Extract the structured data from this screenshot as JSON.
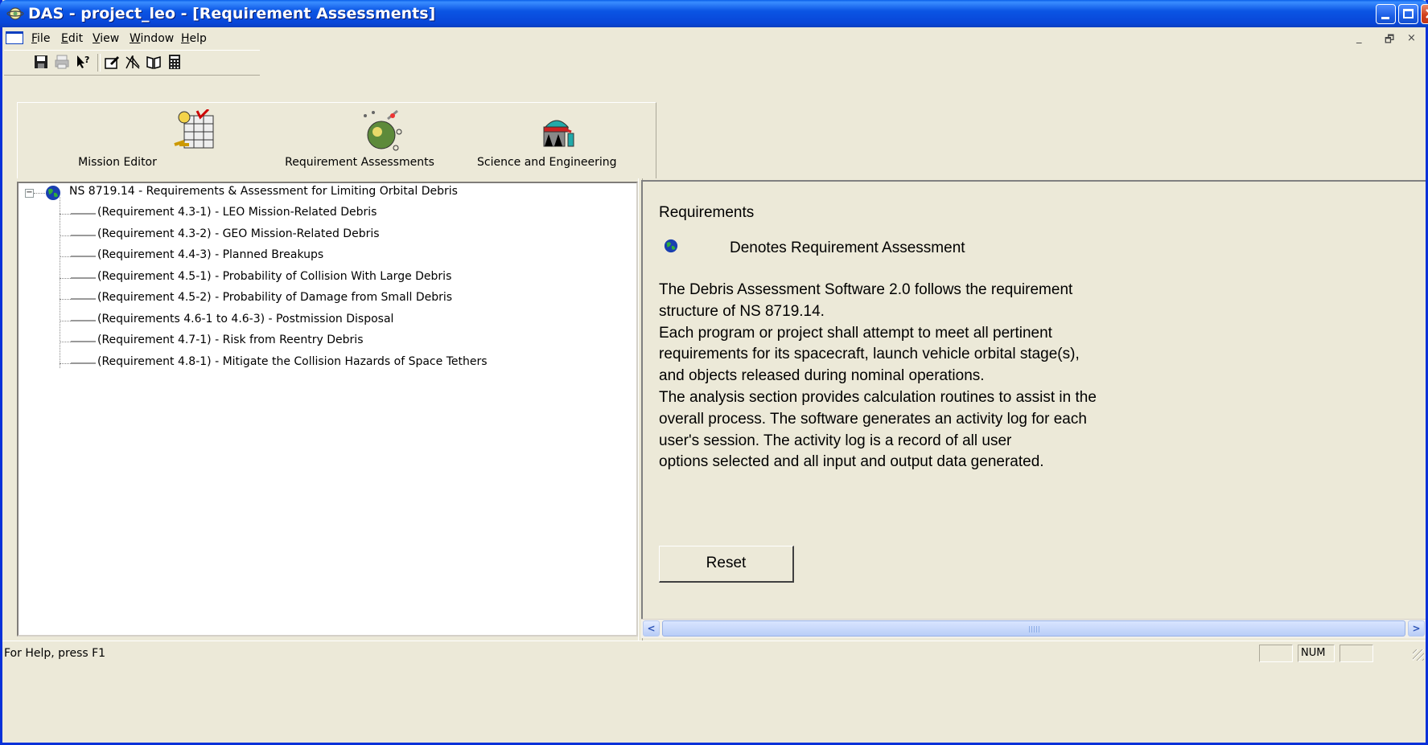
{
  "window": {
    "title": "DAS - project_leo - [Requirement Assessments]",
    "accent_color": "#0a55e4"
  },
  "menubar": {
    "items": [
      {
        "label": "File",
        "mnemonic": "F",
        "rest": "ile"
      },
      {
        "label": "Edit",
        "mnemonic": "E",
        "rest": "dit"
      },
      {
        "label": "View",
        "mnemonic": "V",
        "rest": "iew"
      },
      {
        "label": "Window",
        "mnemonic": "W",
        "rest": "indow"
      },
      {
        "label": "Help",
        "mnemonic": "H",
        "rest": "elp"
      }
    ],
    "mdi_controls": [
      "_",
      "🗗",
      "×"
    ]
  },
  "toolbar": {
    "icons": [
      "save-icon",
      "print-icon",
      "context-help-icon",
      "edit-icon",
      "chart-icon",
      "book-icon",
      "calculator-icon"
    ]
  },
  "modules": [
    {
      "label": "Mission Editor",
      "icon": "mission-editor-icon"
    },
    {
      "label": "Requirement Assessments",
      "icon": "requirement-assessments-icon"
    },
    {
      "label": "Science and Engineering",
      "icon": "science-engineering-icon"
    }
  ],
  "tree": {
    "root": "NS 8719.14 - Requirements & Assessment for Limiting Orbital Debris",
    "children": [
      "(Requirement 4.3-1) - LEO Mission-Related Debris",
      "(Requirement 4.3-2) - GEO Mission-Related Debris",
      "(Requirement 4.4-3) - Planned Breakups",
      "(Requirement 4.5-1) - Probability of Collision With Large Debris",
      "(Requirement 4.5-2) - Probability of Damage from Small Debris",
      "(Requirements 4.6-1 to 4.6-3) - Postmission Disposal",
      "(Requirement 4.7-1) - Risk from Reentry Debris",
      "(Requirement 4.8-1) - Mitigate the Collision Hazards of Space Tethers"
    ]
  },
  "info": {
    "heading": "Requirements",
    "legend": "Denotes Requirement Assessment",
    "body": "The Debris Assessment Software 2.0  follows the requirement\nstructure of NS 8719.14.\nEach program or project shall attempt to meet all pertinent\nrequirements for its spacecraft, launch vehicle orbital stage(s),\nand objects released during nominal operations.\nThe analysis section provides calculation routines to assist in the\noverall process. The software generates an activity log for each\nuser's session. The activity log is a record of all user\noptions selected and all input and output data generated.",
    "reset_label": "Reset"
  },
  "statusbar": {
    "text": "For Help, press F1",
    "num": "NUM"
  }
}
